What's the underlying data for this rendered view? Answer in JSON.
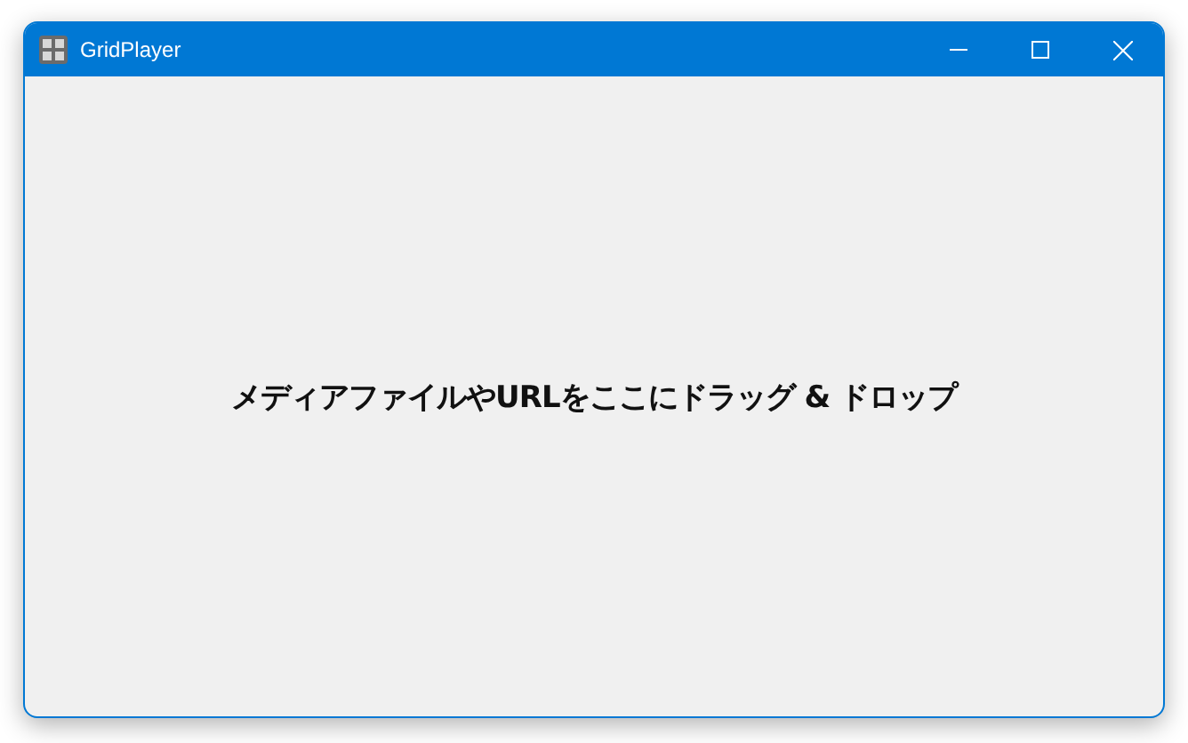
{
  "window": {
    "title": "GridPlayer"
  },
  "drop_hint": "メディアファイルやURLをここにドラッグ & ドロップ"
}
